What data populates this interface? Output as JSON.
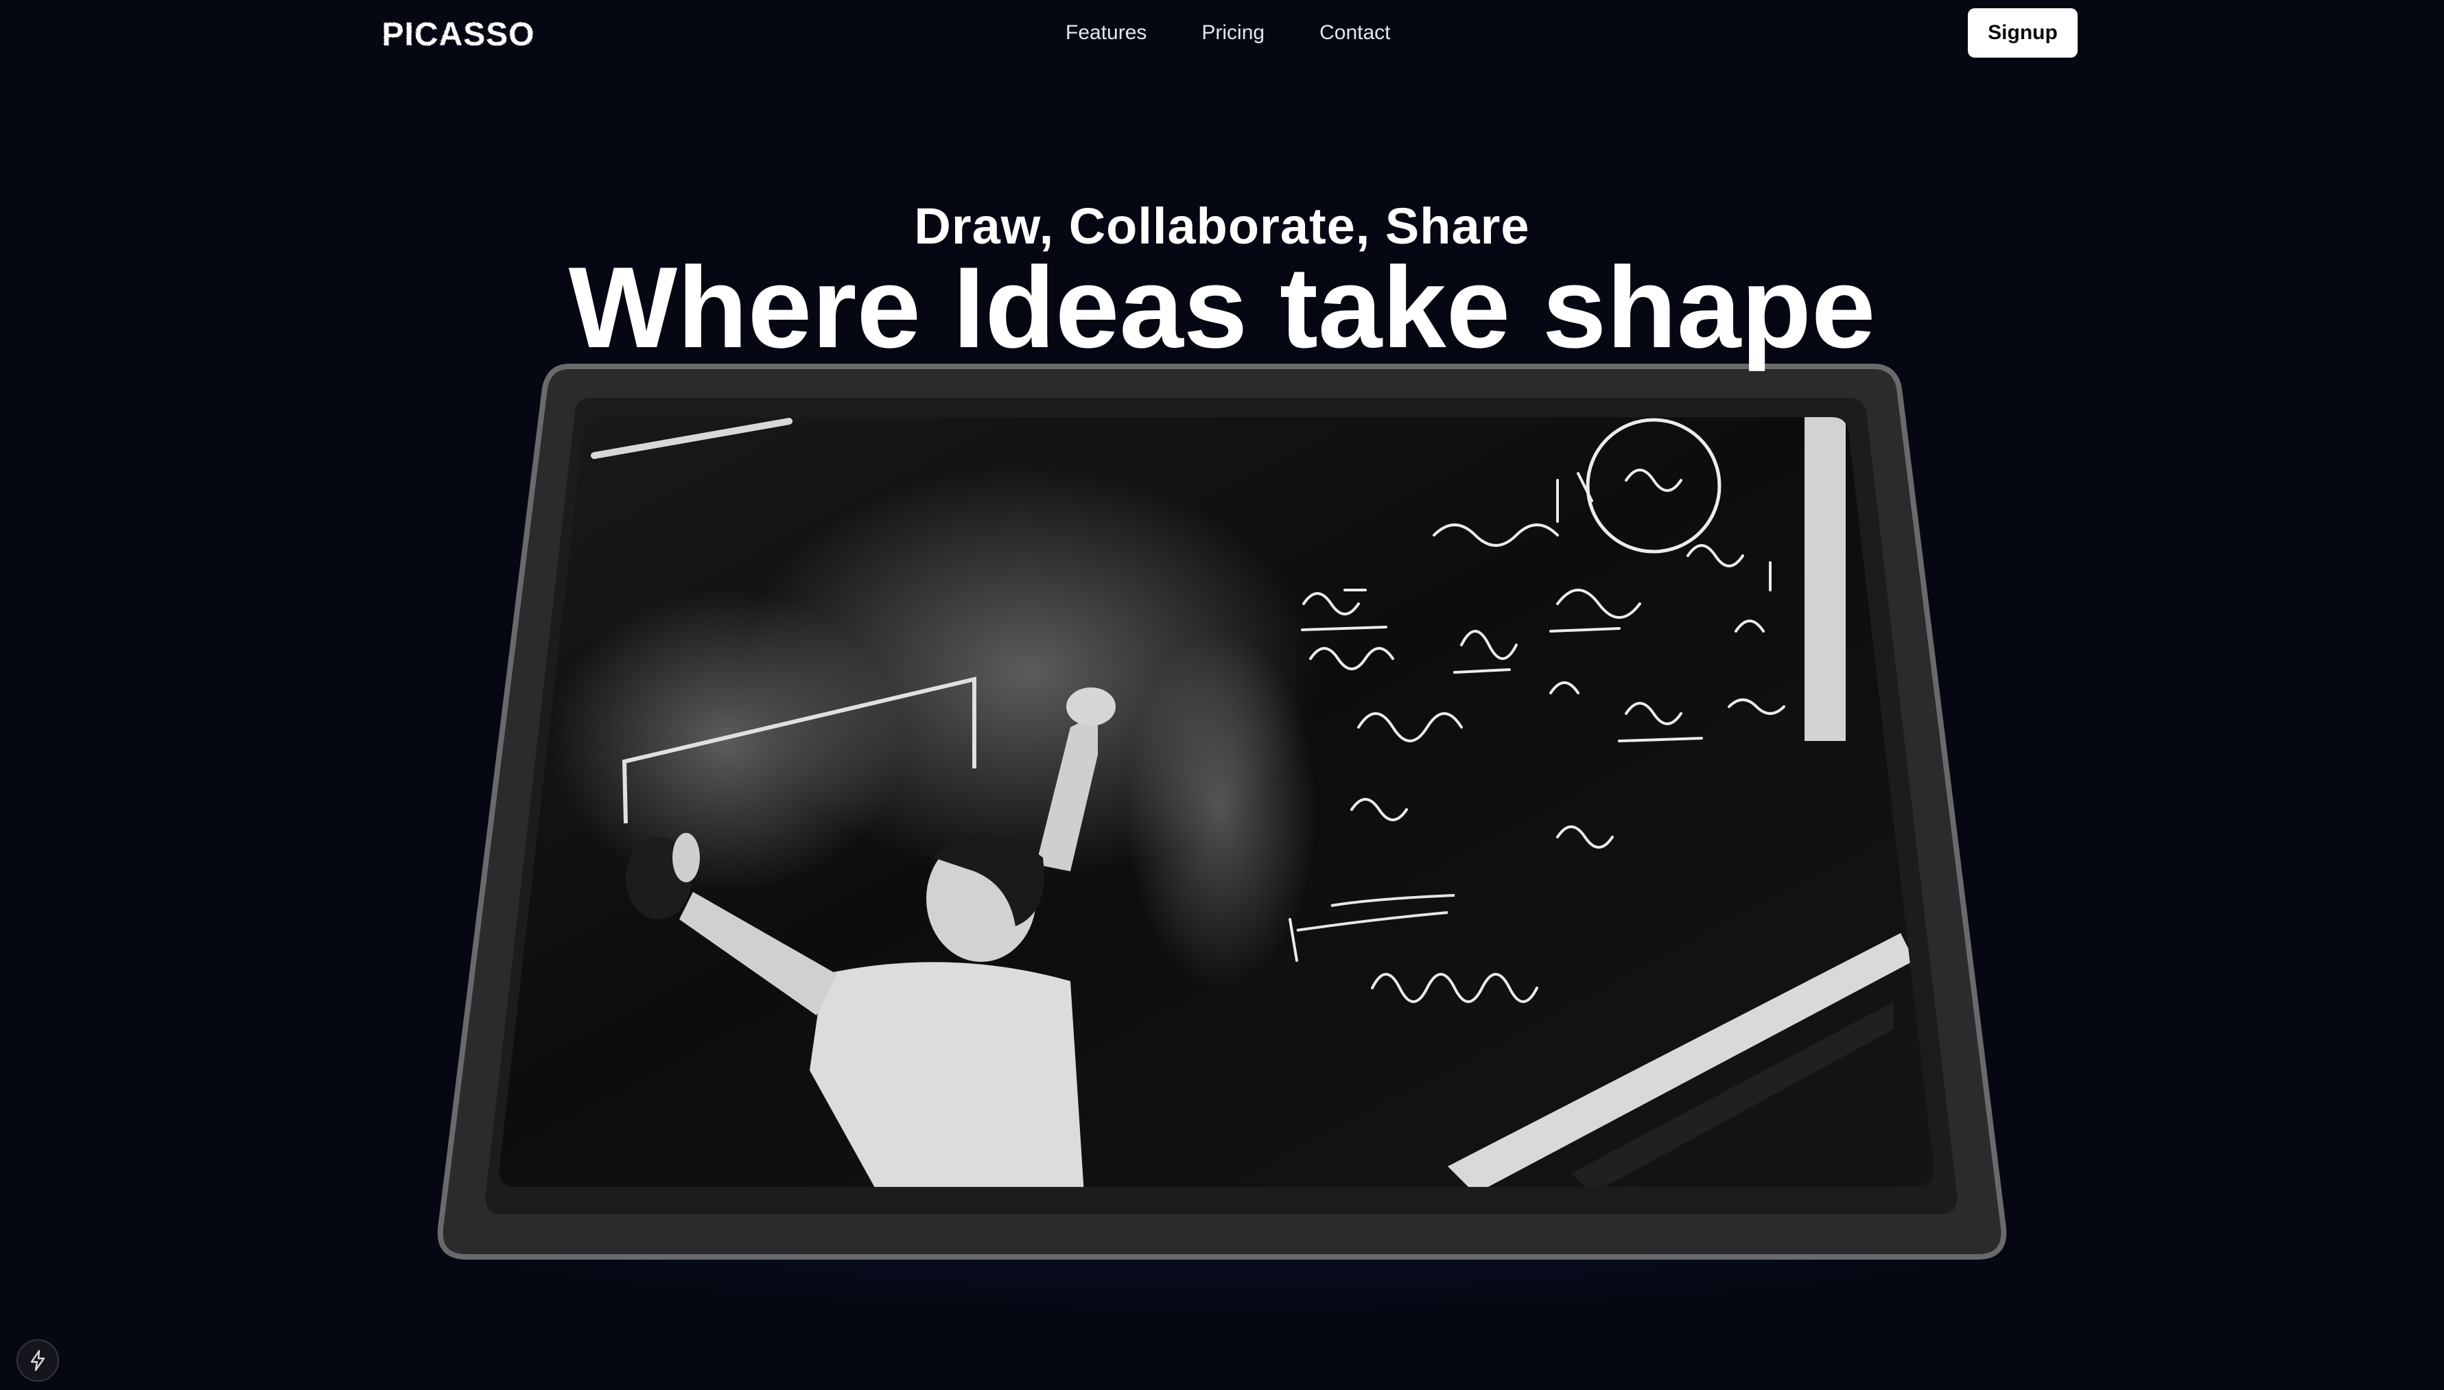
{
  "header": {
    "brand": "PICASSO",
    "nav": [
      {
        "label": "Features"
      },
      {
        "label": "Pricing"
      },
      {
        "label": "Contact"
      }
    ],
    "signup_label": "Signup"
  },
  "hero": {
    "subtitle": "Draw, Collaborate, Share",
    "title": "Where Ideas take shape"
  },
  "media": {
    "description_icon": "tablet-photo",
    "screen_image": "blackboard-lecture-photo"
  },
  "floating": {
    "icon": "bolt-icon"
  },
  "colors": {
    "background": "#050712",
    "button_bg": "#ffffff",
    "button_text": "#0a0a0a",
    "tablet_frame": "#2b2b2d",
    "tablet_bezel": "#1b1b1c"
  }
}
